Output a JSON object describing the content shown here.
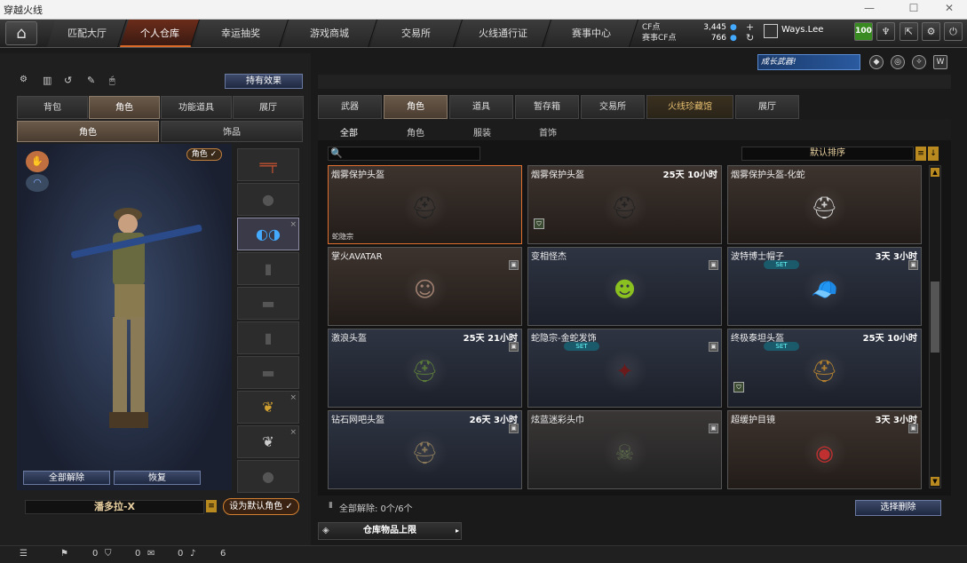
{
  "window": {
    "title": "穿越火线"
  },
  "nav": {
    "tabs": [
      "匹配大厅",
      "个人仓库",
      "幸运抽奖",
      "游戏商城",
      "交易所",
      "火线通行证",
      "赛事中心"
    ],
    "active": 1
  },
  "currency": {
    "cf_label": "CF点",
    "cf_value": "3,445",
    "scf_label": "赛事CF点",
    "scf_value": "766"
  },
  "user": {
    "name": "Ways.Lee",
    "level": "100"
  },
  "badge": {
    "text": "成长武器!"
  },
  "left": {
    "effects_button": "持有效果",
    "tabs": [
      "背包",
      "角色",
      "功能道具",
      "展厅"
    ],
    "active_tab": 1,
    "subtabs": [
      "角色",
      "饰品"
    ],
    "role_badge": "角色",
    "unequip_all": "全部解除",
    "restore": "恢复",
    "char_name": "潘多拉-X",
    "set_default": "设为默认角色"
  },
  "right": {
    "tabs": [
      "武器",
      "角色",
      "道具",
      "暂存箱",
      "交易所",
      "火线珍藏馆",
      "展厅"
    ],
    "active_tab": 1,
    "subtabs": [
      "全部",
      "角色",
      "服装",
      "首饰"
    ],
    "active_subtab": 0,
    "search_placeholder": "",
    "sort": "默认排序",
    "items": [
      {
        "name": "烟雾保护头盔",
        "time": "",
        "tag": "蛇隐宗",
        "style": "brown",
        "selected": true,
        "art": "⛑",
        "color": "#222"
      },
      {
        "name": "烟雾保护头盔",
        "time": "25天 10小时",
        "tag": "",
        "style": "brown",
        "shield": true,
        "art": "⛑",
        "color": "#222"
      },
      {
        "name": "烟雾保护头盔-化蛇",
        "time": "",
        "tag": "",
        "style": "brown",
        "art": "⛑",
        "color": "#ccc"
      },
      {
        "name": "掌火AVATAR",
        "time": "",
        "tag": "",
        "style": "brown",
        "lock": true,
        "art": "☺",
        "color": "#a08070"
      },
      {
        "name": "变相怪杰",
        "time": "",
        "tag": "",
        "style": "blue",
        "lock": true,
        "art": "☻",
        "color": "#8ac020"
      },
      {
        "name": "波特博士帽子",
        "time": "3天 3小时",
        "tag": "",
        "style": "blue",
        "lock": true,
        "set": true,
        "art": "🧢",
        "color": "#332"
      },
      {
        "name": "激浪头盔",
        "time": "25天 21小时",
        "tag": "",
        "style": "blue",
        "lock": true,
        "art": "⛑",
        "color": "#5a7a3a"
      },
      {
        "name": "蛇隐宗-金蛇发饰",
        "time": "",
        "tag": "",
        "style": "blue",
        "lock": true,
        "set": true,
        "art": "✦",
        "color": "#6a1a1a"
      },
      {
        "name": "终极泰坦头盔",
        "time": "25天 10小时",
        "tag": "",
        "style": "blue",
        "set": true,
        "shield": true,
        "art": "⛑",
        "color": "#b08030"
      },
      {
        "name": "钻石网吧头盔",
        "time": "26天 3小时",
        "tag": "",
        "style": "blue",
        "lock": true,
        "art": "⛑",
        "color": "#8a7a5a"
      },
      {
        "name": "炫蓝迷彩头巾",
        "time": "",
        "tag": "",
        "style": "gray",
        "lock": true,
        "art": "☠",
        "color": "#5a6a4a"
      },
      {
        "name": "超缓护目镜",
        "time": "3天 3小时",
        "tag": "",
        "style": "brown",
        "lock": true,
        "art": "◉",
        "color": "#c03030"
      }
    ],
    "unequip_count": "全部解除: 0个/6个",
    "select_delete": "选择删除",
    "capacity": "仓库物品上限"
  },
  "status": {
    "v1": "0",
    "v2": "0",
    "v3": "0",
    "v4": "6"
  }
}
